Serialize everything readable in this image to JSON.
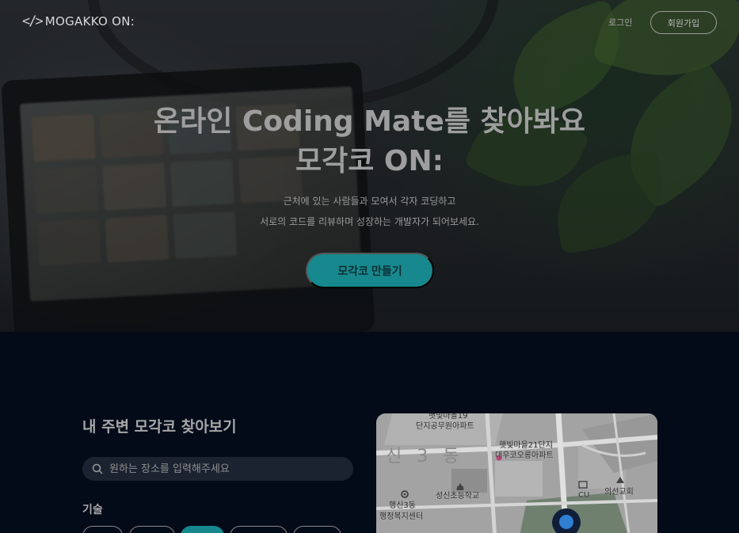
{
  "header": {
    "logo_icon": "</>",
    "logo_text": "MOGAKKO ON:",
    "login": "로그인",
    "signup": "회원가입"
  },
  "hero": {
    "title_line1": "온라인 Coding Mate를 찾아봐요",
    "title_line2": "모각코 ON:",
    "subtitle_line1": "근처에 있는 사람들과 모여서 각자 코딩하고",
    "subtitle_line2": "서로의 코드를 리뷰하며 성장하는 개발자가 되어보세요.",
    "cta": "모각코 만들기"
  },
  "nearby": {
    "title": "내 주변 모각코 찾아보기",
    "search_placeholder": "원하는 장소를 입력해주세요",
    "tech_label": "기술",
    "selected_chip_index": 2
  },
  "map": {
    "labels": [
      "햇빛마을19",
      "단지공무원아파트",
      "신 3 동",
      "햇빛마을21단지",
      "대우코오롱아파트",
      "성신초등학교",
      "CU",
      "의선교회",
      "행신3동",
      "행정복지센터"
    ],
    "marker_icon": "map-pin-icon"
  },
  "colors": {
    "accent": "#17898e",
    "background": "#030a18"
  }
}
